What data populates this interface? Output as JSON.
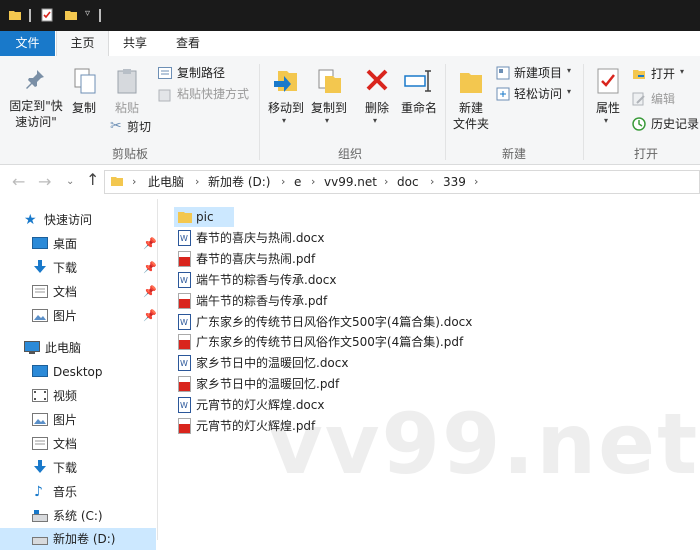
{
  "tabs": {
    "file": "文件",
    "home": "主页",
    "share": "共享",
    "view": "查看"
  },
  "clipboard": {
    "pin": "固定到\"快\n速访问\"",
    "copy": "复制",
    "paste": "粘贴",
    "copy_path": "复制路径",
    "paste_shortcut": "粘贴快捷方式",
    "cut": "剪切",
    "group": "剪贴板"
  },
  "organize": {
    "move_to": "移动到",
    "copy_to": "复制到",
    "delete": "删除",
    "rename": "重命名",
    "group": "组织"
  },
  "new": {
    "new_folder": "新建\n文件夹",
    "new_item": "新建项目",
    "easy_access": "轻松访问",
    "group": "新建"
  },
  "open": {
    "properties": "属性",
    "open": "打开",
    "edit": "编辑",
    "history": "历史记录",
    "group": "打开"
  },
  "breadcrumbs": [
    "此电脑",
    "新加卷 (D:)",
    "e",
    "vv99.net",
    "doc",
    "339"
  ],
  "nav": {
    "quick_access": "快速访问",
    "quick_items": [
      "桌面",
      "下载",
      "文档",
      "图片"
    ],
    "this_pc": "此电脑",
    "pc_items": [
      "Desktop",
      "视频",
      "图片",
      "文档",
      "下载",
      "音乐",
      "系统 (C:)",
      "新加卷 (D:)"
    ]
  },
  "files": [
    {
      "name": "pic",
      "type": "folder"
    },
    {
      "name": "春节的喜庆与热闹.docx",
      "type": "docx"
    },
    {
      "name": "春节的喜庆与热闹.pdf",
      "type": "pdf"
    },
    {
      "name": "端午节的粽香与传承.docx",
      "type": "docx"
    },
    {
      "name": "端午节的粽香与传承.pdf",
      "type": "pdf"
    },
    {
      "name": "广东家乡的传统节日风俗作文500字(4篇合集).docx",
      "type": "docx"
    },
    {
      "name": "广东家乡的传统节日风俗作文500字(4篇合集).pdf",
      "type": "pdf"
    },
    {
      "name": "家乡节日中的温暖回忆.docx",
      "type": "docx"
    },
    {
      "name": "家乡节日中的温暖回忆.pdf",
      "type": "pdf"
    },
    {
      "name": "元宵节的灯火辉煌.docx",
      "type": "docx"
    },
    {
      "name": "元宵节的灯火辉煌.pdf",
      "type": "pdf"
    }
  ],
  "watermark": "vv99.net",
  "colors": {
    "accent": "#1979ca",
    "folder": "#f3c74f",
    "pdf": "#d9251d",
    "doc": "#2b579a",
    "selected": "#cce8ff"
  }
}
